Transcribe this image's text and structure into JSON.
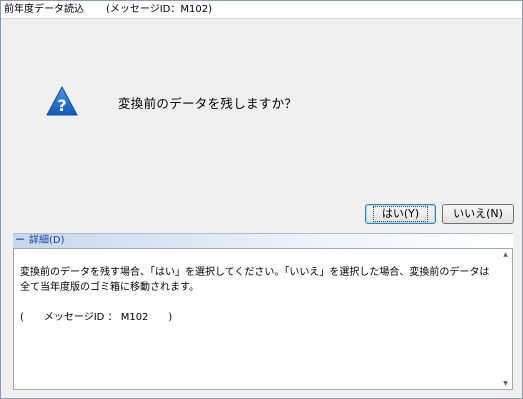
{
  "window": {
    "title": "前年度データ読込",
    "message_id_label": "(メッセージID：M102)"
  },
  "dialog": {
    "icon": "question-icon",
    "question": "変換前のデータを残しますか？",
    "accent_color": "#1c6fc9"
  },
  "buttons": {
    "yes_label": "はい(Y)",
    "no_label": "いいえ(N)"
  },
  "details": {
    "header_label": "詳細(D)",
    "toggle_symbol": "－",
    "text": "変換前のデータを残す場合、「はい」を選択してください。「いいえ」を選択した場合、変換前のデータは全て当年度版のゴミ箱に移動されます。\n\n(　　メッセージID ： M102　　)"
  }
}
